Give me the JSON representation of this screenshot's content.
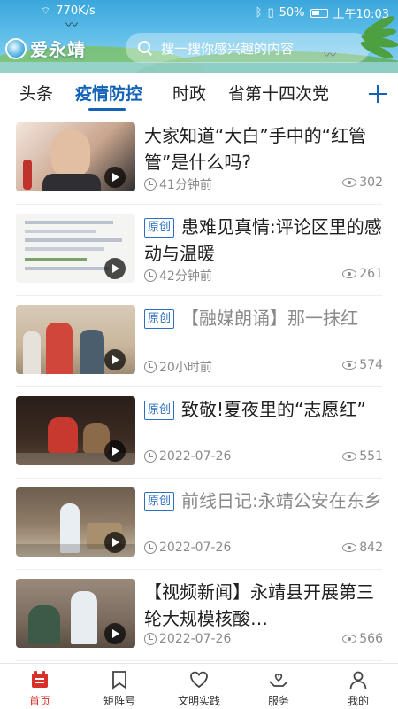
{
  "status_bar": {
    "network_speed": "770K/s",
    "battery": "50%",
    "time": "上午10:03"
  },
  "header": {
    "logo_text": "爱永靖",
    "search_placeholder": "搜一搜你感兴趣的内容"
  },
  "tabs": [
    {
      "label": "头条",
      "active": false
    },
    {
      "label": "疫情防控",
      "active": true
    },
    {
      "label": "时政",
      "active": false
    },
    {
      "label": "省第十四次党",
      "active": false
    }
  ],
  "news": [
    {
      "badge": "",
      "title": "大家知道“大白”手中的“红管管”是什么吗?",
      "time": "41分钟前",
      "views": "302",
      "thumb_colors": [
        "#f3e6dc",
        "#c9a58e",
        "#2e2e2e"
      ]
    },
    {
      "badge": "原创",
      "title": "患难见真情:评论区里的感动与温暖",
      "time": "42分钟前",
      "views": "261",
      "thumb_colors": [
        "#f4f4f2",
        "#d6dde5",
        "#7aa36b"
      ]
    },
    {
      "badge": "原创",
      "title": "【融媒朗诵】那一抹红",
      "time": "20小时前",
      "views": "574",
      "thumb_colors": [
        "#c9b59b",
        "#d0463a",
        "#4b5e6e"
      ]
    },
    {
      "badge": "原创",
      "title": "致敬!夏夜里的“志愿红”",
      "time": "2022-07-26",
      "views": "551",
      "thumb_colors": [
        "#3a2a22",
        "#c7392f",
        "#8a6a48"
      ]
    },
    {
      "badge": "原创",
      "title": "前线日记:永靖公安在东乡",
      "time": "2022-07-26",
      "views": "842",
      "thumb_colors": [
        "#8d7a66",
        "#c8b8a2",
        "#e9eef2"
      ]
    },
    {
      "badge": "",
      "title": "【视频新闻】永靖县开展第三轮大规模核酸…",
      "time": "2022-07-26",
      "views": "566",
      "thumb_colors": [
        "#7b6b5e",
        "#e8edf2",
        "#3c5a48"
      ]
    }
  ],
  "bottom_nav": [
    {
      "label": "首页",
      "icon": "home-icon",
      "active": true
    },
    {
      "label": "矩阵号",
      "icon": "bookmark-icon",
      "active": false
    },
    {
      "label": "文明实践",
      "icon": "heart-icon",
      "active": false
    },
    {
      "label": "服务",
      "icon": "service-hands-icon",
      "active": false
    },
    {
      "label": "我的",
      "icon": "person-icon",
      "active": false
    }
  ],
  "colors": {
    "accent": "#1262b8",
    "nav_active": "#d9312a",
    "badge": "#2a6fc0"
  }
}
